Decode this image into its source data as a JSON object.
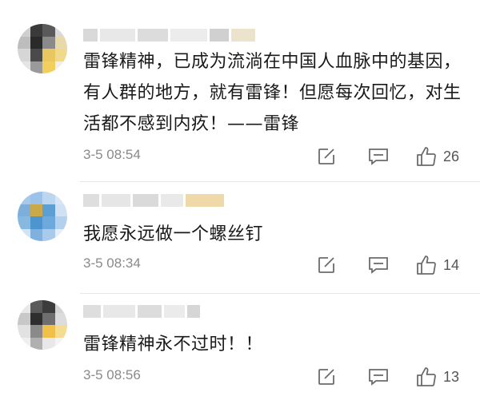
{
  "colors": {
    "text": "#1a1a1a",
    "meta": "#8a8a8a",
    "icon": "#6b6b6b",
    "divider": "#e6e6e6"
  },
  "comments": [
    {
      "text": "雷锋精神，已成为流淌在中国人血脉中的基因，有人群的地方，就有雷锋！但愿每次回忆，对生活都不感到内疚！——雷锋",
      "timestamp": "3-5 08:54",
      "likes": "26",
      "icons": [
        "share-icon",
        "comment-icon",
        "like-icon"
      ]
    },
    {
      "text": "我愿永远做一个螺丝钉",
      "timestamp": "3-5 08:34",
      "likes": "14",
      "icons": [
        "share-icon",
        "comment-icon",
        "like-icon"
      ]
    },
    {
      "text": "雷锋精神永不过时！！",
      "timestamp": "3-5 08:56",
      "likes": "13",
      "icons": [
        "share-icon",
        "comment-icon",
        "like-icon"
      ]
    }
  ]
}
